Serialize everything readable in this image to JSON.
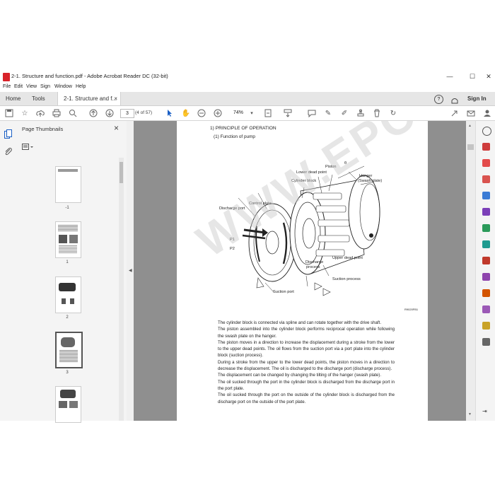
{
  "window": {
    "title": "2-1. Structure and function.pdf - Adobe Acrobat Reader DC (32-bit)",
    "minimize": "—",
    "maximize": "☐",
    "close": "✕"
  },
  "menu": [
    "File",
    "Edit",
    "View",
    "Sign",
    "Window",
    "Help"
  ],
  "tabs": {
    "home": "Home",
    "tools": "Tools",
    "document": "2-1. Structure and f...",
    "document_close": "×",
    "help": "?",
    "sign_in": "Sign In"
  },
  "toolbar": {
    "page_number": "3",
    "page_count": "(4 of 57)",
    "zoom": "74%"
  },
  "thumbnails": {
    "header": "Page Thumbnails",
    "close": "×",
    "items": [
      {
        "label": "-1"
      },
      {
        "label": "1"
      },
      {
        "label": "2"
      },
      {
        "label": "3"
      },
      {
        "label": ""
      }
    ]
  },
  "document": {
    "heading": "1)  PRINCIPLE OF OPERATION",
    "subheading": "(1)  Function of pump",
    "watermark": "WWW.EPCFEED.COM",
    "figure_code": "R9020FB1",
    "labels": {
      "piston": "Piston",
      "lower_dead_point": "Lower dead point",
      "cylinder_block": "Cylinder block",
      "hanger": "Hanger",
      "swash_plate": "(Swash plate)",
      "control_plate": "Control plate",
      "discharge_port": "Discharge port",
      "p1": "P1",
      "p2": "P2",
      "upper_dead_point": "Upper dead point",
      "discharge": "Discharge",
      "process": "process",
      "suction_process": "Suction process",
      "suction_port": "Suction port",
      "theta": "θ"
    },
    "paragraphs": [
      "The cylinder block is connected via spline and can rotate together with the drive shaft.",
      "The piston assembled into the cylinder block performs reciprocal operation while following the swash plate on the hanger.",
      "The piston moves in a direction to increase the displacement during a stroke from the lower to the upper dead points.  The oil flows from the suction port via a port plate into the cylinder block (suction process).",
      "During a stroke from the upper to the lower dead points, the piston moves in a direction to decrease the displacement. The oil is discharged to the discharge port (discharge process).",
      "The displacement can be changed by changing the tilting of the hanger (swash plate).",
      "The oil sucked through the port in the cylinder block is discharged from the discharge port in the port plate.",
      "The oil sucked through the port on the outside of the cylinder block is discharged from the discharge port on the outside of the port plate."
    ]
  }
}
